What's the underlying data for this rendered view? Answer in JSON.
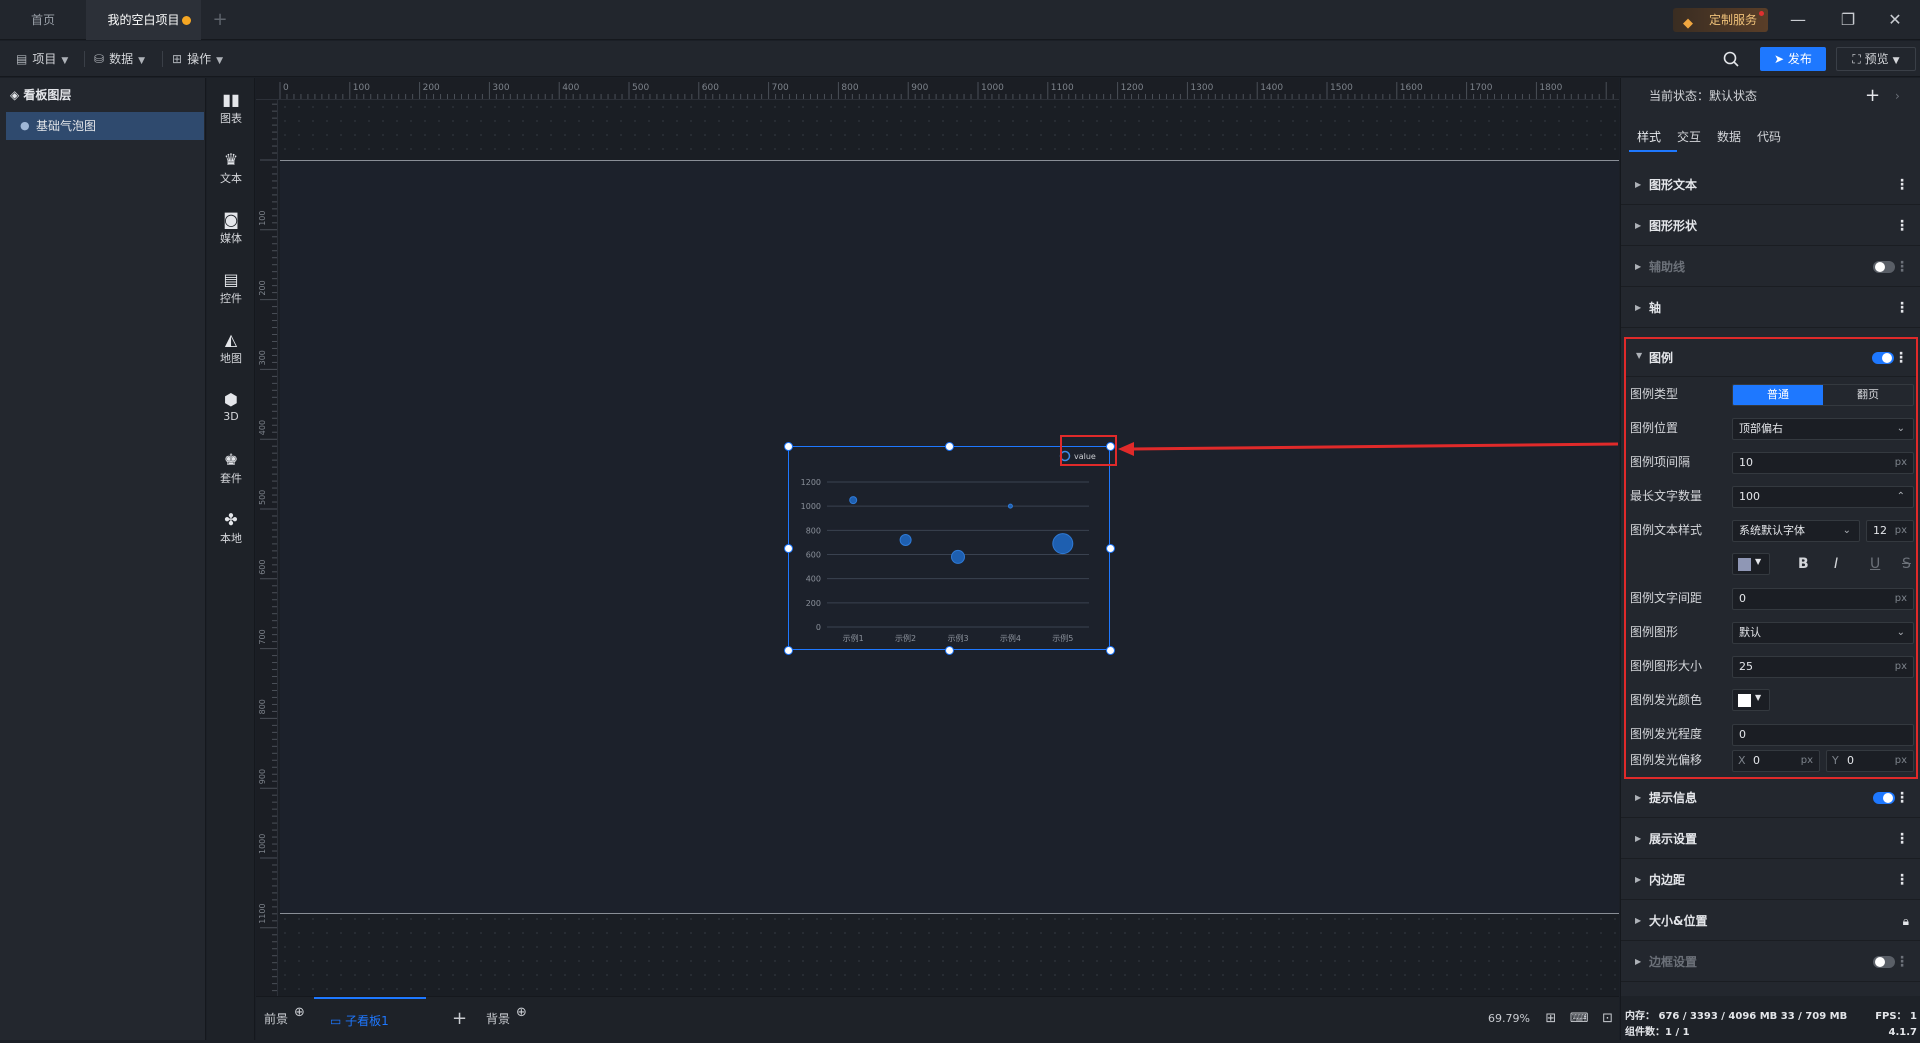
{
  "titlebar": {
    "tabs": [
      {
        "label": "首页"
      },
      {
        "label": "我的空白项目"
      }
    ],
    "custom_service": "定制服务"
  },
  "toolbar": {
    "menus": [
      {
        "label": "项目"
      },
      {
        "label": "数据"
      },
      {
        "label": "操作"
      }
    ],
    "publish": "发布",
    "preview": "预览"
  },
  "layers": {
    "title": "看板图层",
    "items": [
      {
        "label": "基础气泡图"
      }
    ]
  },
  "components": [
    {
      "label": "图表",
      "icon": "chart-icon"
    },
    {
      "label": "文本",
      "icon": "text-icon"
    },
    {
      "label": "媒体",
      "icon": "media-icon"
    },
    {
      "label": "控件",
      "icon": "control-icon"
    },
    {
      "label": "地图",
      "icon": "map-icon"
    },
    {
      "label": "3D",
      "icon": "cube-icon"
    },
    {
      "label": "套件",
      "icon": "kit-icon"
    },
    {
      "label": "本地",
      "icon": "local-icon"
    }
  ],
  "ruler": {
    "top_labels": [
      "0",
      "100",
      "200",
      "300",
      "400",
      "500",
      "600",
      "700",
      "800",
      "900",
      "1000",
      "1100",
      "1200",
      "1300",
      "1400",
      "1500",
      "1600",
      "1700",
      "1800",
      "1900"
    ],
    "left_labels": [
      "100",
      "200",
      "300",
      "400",
      "500",
      "600",
      "700",
      "800",
      "900",
      "1000",
      "1100"
    ]
  },
  "chart_data": {
    "type": "scatter",
    "categories": [
      "示例1",
      "示例2",
      "示例3",
      "示例4",
      "示例5"
    ],
    "series": [
      {
        "name": "value",
        "values": [
          1050,
          720,
          580,
          1000,
          690
        ],
        "sizes": [
          7,
          11,
          13,
          4,
          20
        ]
      }
    ],
    "ylim": [
      0,
      1200
    ],
    "y_ticks": [
      0,
      200,
      400,
      600,
      800,
      1000,
      1200
    ],
    "legend_position": "top-right",
    "grid": true,
    "color": "#1e5fb0"
  },
  "bottombar": {
    "front": "前景",
    "board": "子看板1",
    "background": "背景",
    "zoom": "69.79%"
  },
  "panel": {
    "current_state_label": "当前状态：默认状态",
    "tabs": [
      "样式",
      "交互",
      "数据",
      "代码"
    ],
    "sections_top": [
      {
        "label": "图形文本",
        "disabled": false
      },
      {
        "label": "图形形状",
        "disabled": false
      },
      {
        "label": "辅助线",
        "disabled": true
      },
      {
        "label": "轴",
        "disabled": false
      }
    ],
    "legend": {
      "title": "图例",
      "type_label": "图例类型",
      "type_options": [
        "普通",
        "翻页"
      ],
      "position_label": "图例位置",
      "position_value": "顶部偏右",
      "gap_label": "图例项间隔",
      "gap_value": "10",
      "maxchars_label": "最长文字数量",
      "maxchars_value": "100",
      "textstyle_label": "图例文本样式",
      "font_value": "系统默认字体",
      "font_size": "12",
      "textcolor": "#8f97b5",
      "spacing_label": "图例文字间距",
      "spacing_value": "0",
      "shape_label": "图例图形",
      "shape_value": "默认",
      "shapesize_label": "图例图形大小",
      "shapesize_value": "25",
      "glowcolor_label": "图例发光颜色",
      "glowcolor": "#ffffff",
      "glowlevel_label": "图例发光程度",
      "glowlevel_value": "0",
      "glowoffset_label": "图例发光偏移",
      "offset_x": "0",
      "offset_y": "0",
      "unit": "px",
      "x": "X",
      "y": "Y"
    },
    "sections_bottom": [
      {
        "label": "提示信息",
        "disabled": false
      },
      {
        "label": "展示设置",
        "disabled": false
      },
      {
        "label": "内边距",
        "disabled": false
      },
      {
        "label": "大小&位置",
        "disabled": false
      },
      {
        "label": "边框设置",
        "disabled": true
      }
    ],
    "status": {
      "memory": "内存：  676 / 3393 / 4096 MB  33 / 709 MB",
      "components": "组件数：1 / 1",
      "fps": "FPS：  1",
      "version": "4.1.7"
    }
  }
}
